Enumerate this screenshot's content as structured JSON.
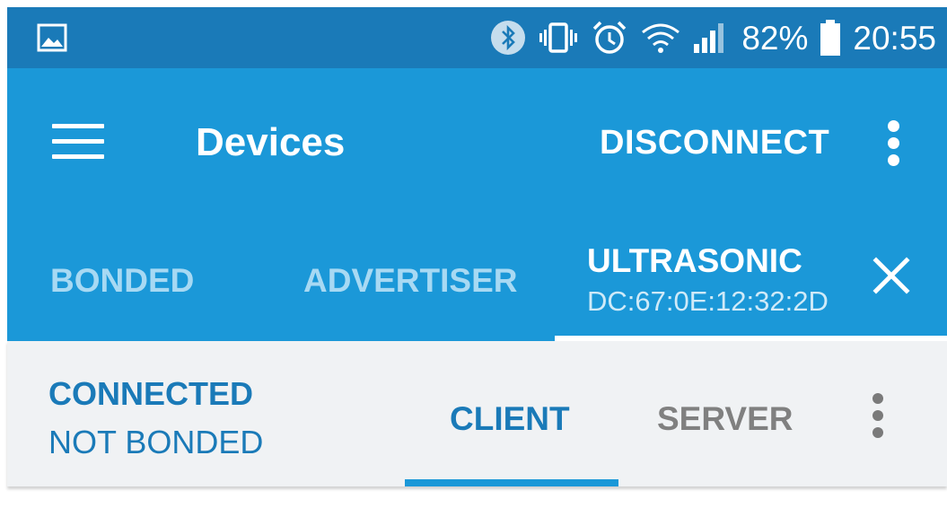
{
  "status_bar": {
    "battery_percent": "82%",
    "time": "20:55",
    "icons": [
      "image-icon",
      "bluetooth-icon",
      "vibrate-icon",
      "alarm-icon",
      "wifi-icon",
      "signal-icon",
      "battery-icon"
    ]
  },
  "toolbar": {
    "title": "Devices",
    "disconnect_label": "DISCONNECT",
    "icons": [
      "menu-icon",
      "more-vert-icon"
    ]
  },
  "device_tabs": {
    "bonded_label": "BONDED",
    "advertiser_label": "ADVERTISER",
    "device_name": "ULTRASONIC",
    "device_address": "DC:67:0E:12:32:2D",
    "icons": [
      "close-icon"
    ]
  },
  "connection": {
    "state": "CONNECTED",
    "bond_state": "NOT BONDED",
    "client_label": "CLIENT",
    "server_label": "SERVER",
    "icons": [
      "more-vert-icon"
    ]
  },
  "colors": {
    "status_bar": "#1a7ab8",
    "toolbar": "#1b98d8",
    "accent": "#1a7ab8",
    "inactive_tab": "#a7d9f3",
    "panel_bg": "#f0f2f4"
  }
}
